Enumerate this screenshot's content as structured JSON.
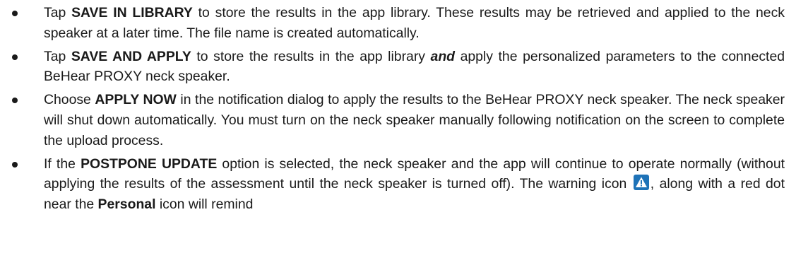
{
  "bullets": [
    {
      "a": "Tap ",
      "b": "SAVE IN LIBRARY",
      "c": " to store the results in the app library. These results may be retrieved and applied to the neck speaker at a later time. The file name is created automatically."
    },
    {
      "a": "Tap ",
      "b": "SAVE AND APPLY",
      "c": " to store the results in the app library ",
      "d": "and",
      "e": " apply the personalized parameters to the connected BeHear PROXY neck speaker."
    },
    {
      "a": "Choose ",
      "b": "APPLY NOW",
      "c": " in the notification dialog to apply the results to the BeHear PROXY neck speaker. The neck speaker will shut down automatically. You must turn on the neck speaker manually following notification on the screen to complete the upload process."
    },
    {
      "a": "If the ",
      "b": "POSTPONE UPDATE",
      "c": " option is selected, the neck speaker and the app will continue to operate normally (without applying the results of the assessment until the neck speaker is turned off). The warning icon ",
      "d": ", along with a red dot near the ",
      "e": "Personal",
      "f": " icon will remind"
    }
  ],
  "icons": {
    "warning": "warning-icon"
  },
  "colors": {
    "icon_bg": "#1e73b8"
  }
}
